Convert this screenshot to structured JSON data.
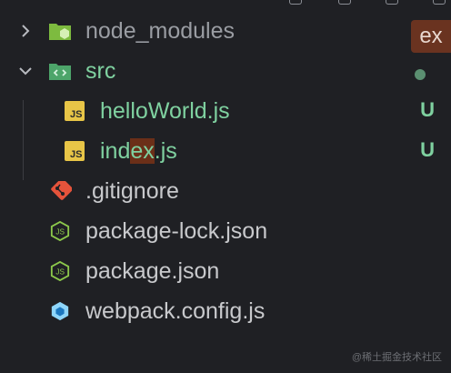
{
  "explorer": {
    "items": [
      {
        "label": "node_modules",
        "kind": "folder",
        "icon": "node-folder-icon",
        "style": "dim",
        "badge": ""
      },
      {
        "label": "src",
        "kind": "folder-open",
        "icon": "src-folder-icon",
        "style": "green",
        "badge": "dot"
      },
      {
        "label": "helloWorld.js",
        "kind": "file",
        "icon": "js-file-icon",
        "style": "green",
        "badge": "U"
      },
      {
        "label_parts": [
          "ind",
          "ex",
          ".js"
        ],
        "label": "index.js",
        "kind": "file",
        "icon": "js-file-icon",
        "style": "green",
        "badge": "U"
      },
      {
        "label": ".gitignore",
        "kind": "file",
        "icon": "git-icon",
        "style": "normal",
        "badge": ""
      },
      {
        "label": "package-lock.json",
        "kind": "file",
        "icon": "nodejs-icon",
        "style": "normal",
        "badge": ""
      },
      {
        "label": "package.json",
        "kind": "file",
        "icon": "nodejs-icon",
        "style": "normal",
        "badge": ""
      },
      {
        "label": "webpack.config.js",
        "kind": "file",
        "icon": "webpack-icon",
        "style": "normal",
        "badge": ""
      }
    ],
    "search_badge": "ex",
    "untracked_badge": "U"
  },
  "watermark": "@稀土掘金技术社区",
  "colors": {
    "background": "#1f2024",
    "green_text": "#7fd1a0",
    "normal_text": "#c8c9cc",
    "js_icon": "#e8c547",
    "git_icon": "#e5533b",
    "node_icon": "#8cc84b",
    "highlight": "#6b2f18"
  }
}
